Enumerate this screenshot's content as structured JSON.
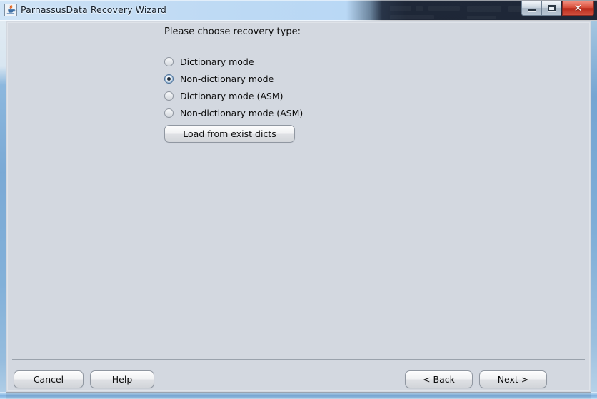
{
  "window": {
    "title": "ParnassusData Recovery Wizard",
    "icon": "java-coffee-cup-icon",
    "caption_buttons": [
      {
        "name": "minimize",
        "glyph": "minimize-icon",
        "label": "Minimize"
      },
      {
        "name": "maximize",
        "glyph": "maximize-icon",
        "label": "Maximize"
      },
      {
        "name": "close",
        "glyph": "close-icon",
        "label": "✕"
      }
    ]
  },
  "content": {
    "heading": "Please choose recovery type:",
    "recovery_options": [
      {
        "label": "Dictionary mode",
        "selected": false
      },
      {
        "label": "Non-dictionary mode",
        "selected": true
      },
      {
        "label": "Dictionary mode (ASM)",
        "selected": false
      },
      {
        "label": "Non-dictionary mode (ASM)",
        "selected": false
      }
    ],
    "load_dicts_label": "Load from exist dicts"
  },
  "footer": {
    "cancel_label": "Cancel",
    "help_label": "Help",
    "back_label": "<  Back",
    "next_label": "Next  >"
  },
  "colors": {
    "client_background": "#d3d8e0",
    "title_glass": "#bcd9f4",
    "frame_blue": "#83b5e3",
    "close_red": "#c23b28",
    "text": "#0c0c0c",
    "separator": "#9aa2ac"
  }
}
